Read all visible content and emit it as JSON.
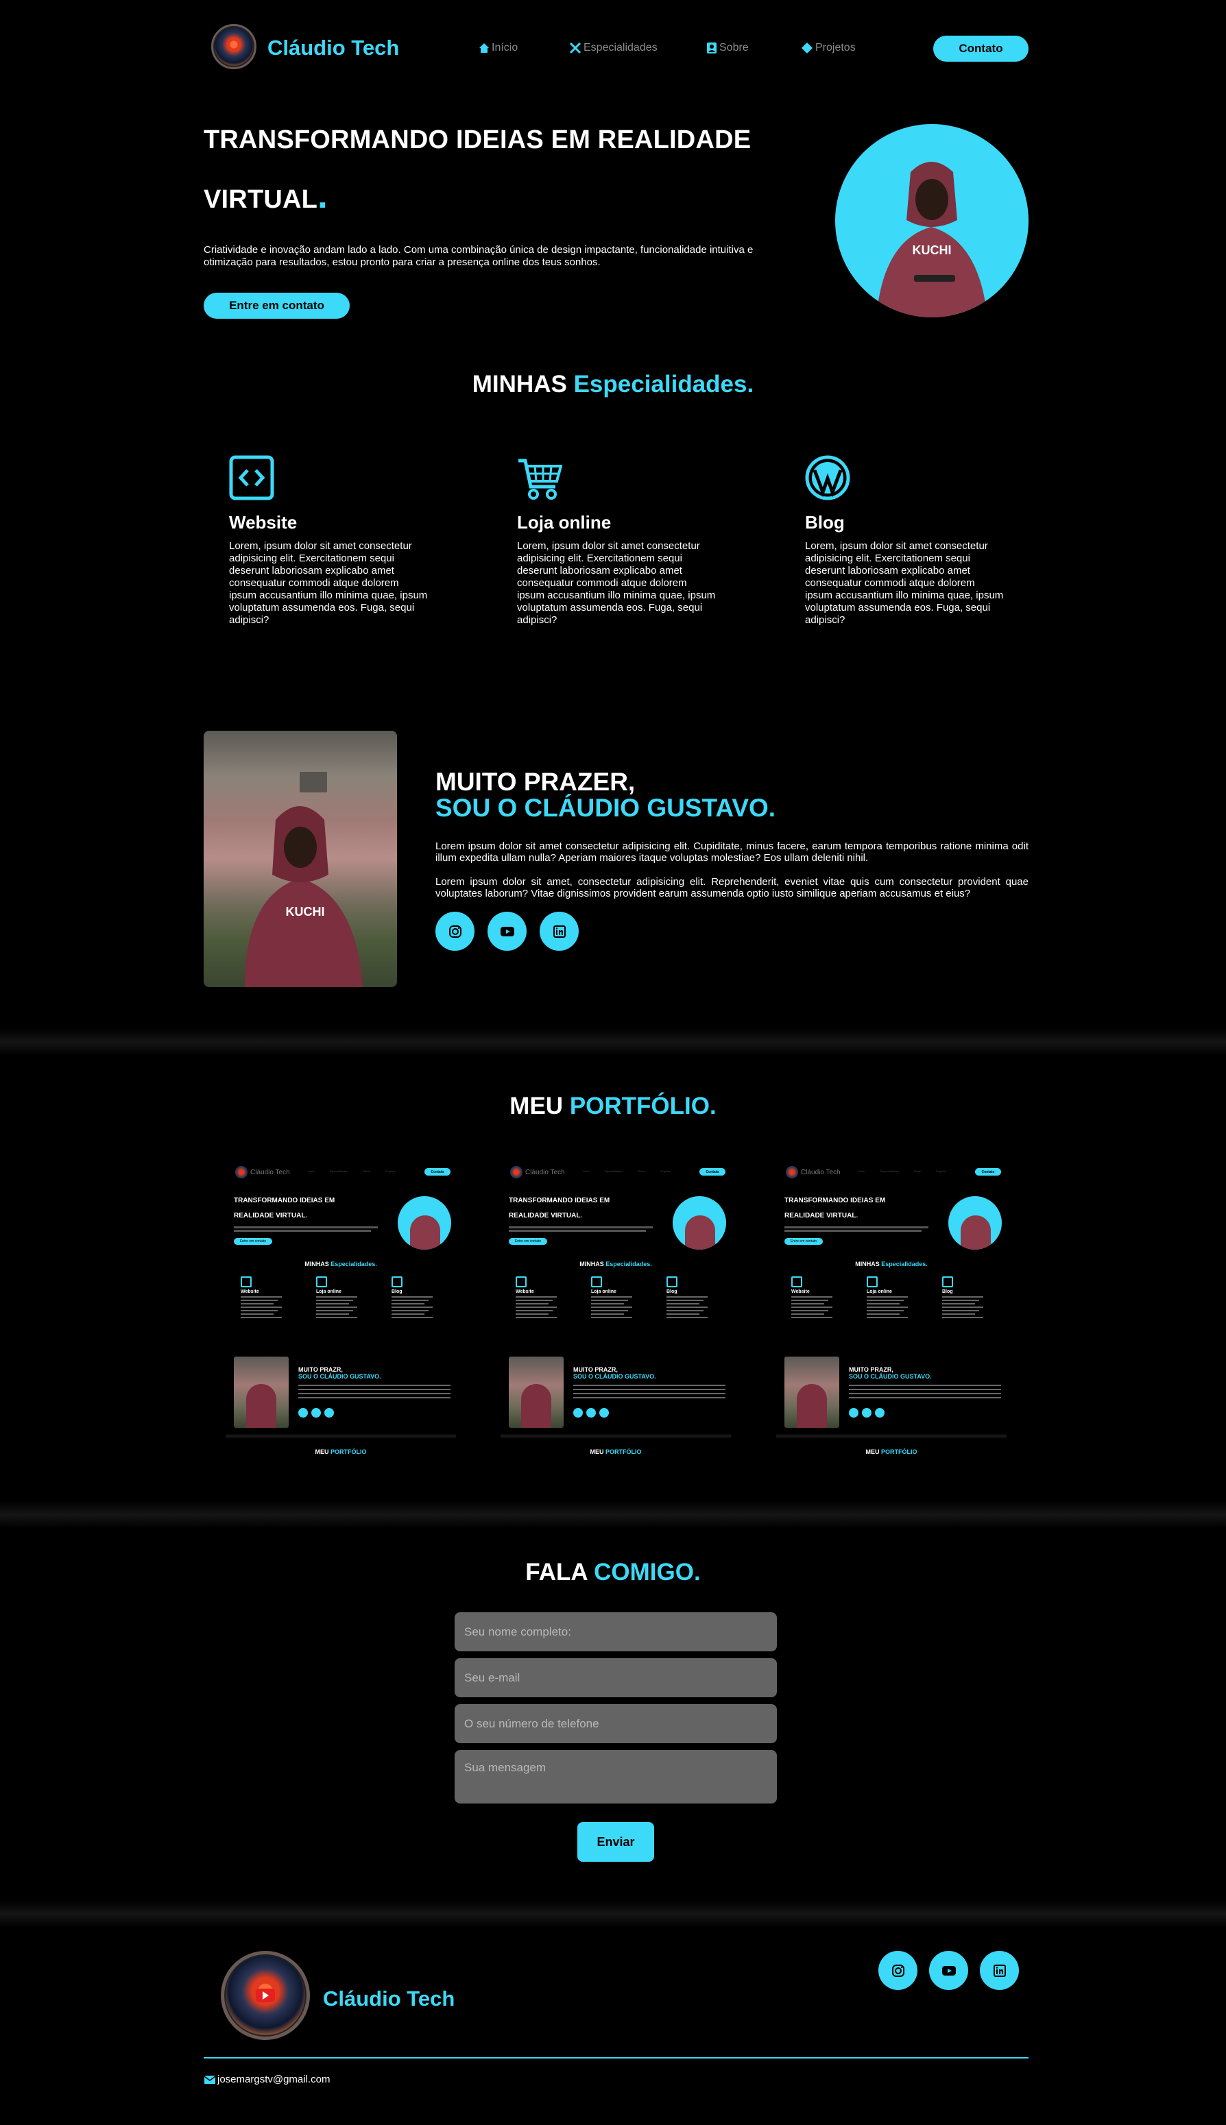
{
  "header": {
    "brand": "Cláudio Tech",
    "nav": [
      {
        "label": "Início",
        "icon": "home-icon"
      },
      {
        "label": "Especialidades",
        "icon": "tools-icon"
      },
      {
        "label": "Sobre",
        "icon": "contact-card-icon"
      },
      {
        "label": "Projetos",
        "icon": "projects-icon"
      }
    ],
    "contact_button": "Contato"
  },
  "hero": {
    "title_line1": "TRANSFORMANDO IDEIAS EM REALIDADE",
    "title_line2": "VIRTUAL",
    "dot": ".",
    "description": "Criatividade e inovação andam lado a lado. Com uma combinação única de design impactante, funcionalidade intuitiva e otimização para resultados, estou pronto para criar a presença online dos teus sonhos.",
    "cta": "Entre em contato",
    "avatar_text": "KUCHI"
  },
  "specialties": {
    "title_white": "MINHAS",
    "title_cyan": "Especialidades.",
    "cards": [
      {
        "icon": "code-icon",
        "title": "Website",
        "text": "Lorem, ipsum dolor sit amet consectetur adipisicing elit. Exercitationem sequi deserunt laboriosam explicabo amet consequatur commodi atque dolorem ipsum accusantium illo minima quae, ipsum voluptatum assumenda eos. Fuga, sequi adipisci?"
      },
      {
        "icon": "cart-icon",
        "title": "Loja online",
        "text": "Lorem, ipsum dolor sit amet consectetur adipisicing elit. Exercitationem sequi deserunt laboriosam explicabo amet consequatur commodi atque dolorem ipsum accusantium illo minima quae, ipsum voluptatum assumenda eos. Fuga, sequi adipisci?"
      },
      {
        "icon": "wordpress-icon",
        "title": "Blog",
        "text": "Lorem, ipsum dolor sit amet consectetur adipisicing elit. Exercitationem sequi deserunt laboriosam explicabo amet consequatur commodi atque dolorem ipsum accusantium illo minima quae, ipsum voluptatum assumenda eos. Fuga, sequi adipisci?"
      }
    ]
  },
  "about": {
    "title_line1": "MUITO PRAZER,",
    "title_line2": "SOU O CLÁUDIO GUSTAVO.",
    "para1": "Lorem ipsum dolor sit amet consectetur adipisicing elit. Cupiditate, minus facere, earum tempora temporibus ratione minima odit illum expedita ullam nulla? Aperiam maiores itaque voluptas molestiae? Eos ullam deleniti nihil.",
    "para2": "Lorem ipsum dolor sit amet, consectetur adipisicing elit. Reprehenderit, eveniet vitae quis cum consectetur provident quae voluptates laborum? Vitae dignissimos provident earum assumenda optio iusto similique aperiam accusamus et eius?",
    "socials": [
      "instagram-icon",
      "youtube-icon",
      "linkedin-icon"
    ]
  },
  "portfolio": {
    "title_white": "MEU",
    "title_cyan": "PORTFÓLIO.",
    "thumb": {
      "brand": "Cláudio Tech",
      "nav": [
        "Início",
        "Especialidades",
        "Sobre",
        "Projetos"
      ],
      "contact": "Contato",
      "hero1": "TRANSFORMANDO IDEIAS EM",
      "hero2": "REALIDADE VIRTUAL",
      "cta": "Entre em contato",
      "spec_white": "MINHAS",
      "spec_cyan": "Especialidades.",
      "cards": [
        "Website",
        "Loja online",
        "Blog"
      ],
      "about1": "MUITO PRAZR,",
      "about2": "SOU O CLÁUDIO GUSTAVO.",
      "port_white": "MEU",
      "port_cyan": "PORTFÓLIO"
    }
  },
  "contact": {
    "title_white": "FALA",
    "title_cyan": "COMIGO.",
    "name_placeholder": "Seu nome completo:",
    "email_placeholder": "Seu e-mail",
    "phone_placeholder": "O seu número de telefone",
    "message_placeholder": "Sua mensagem",
    "submit": "Enviar"
  },
  "footer": {
    "brand": "Cláudio Tech",
    "email": "josemargstv@gmail.com",
    "socials": [
      "instagram-icon",
      "youtube-icon",
      "linkedin-icon"
    ]
  },
  "colors": {
    "accent": "#3cd9f8",
    "background": "#000000",
    "input": "#646464"
  }
}
